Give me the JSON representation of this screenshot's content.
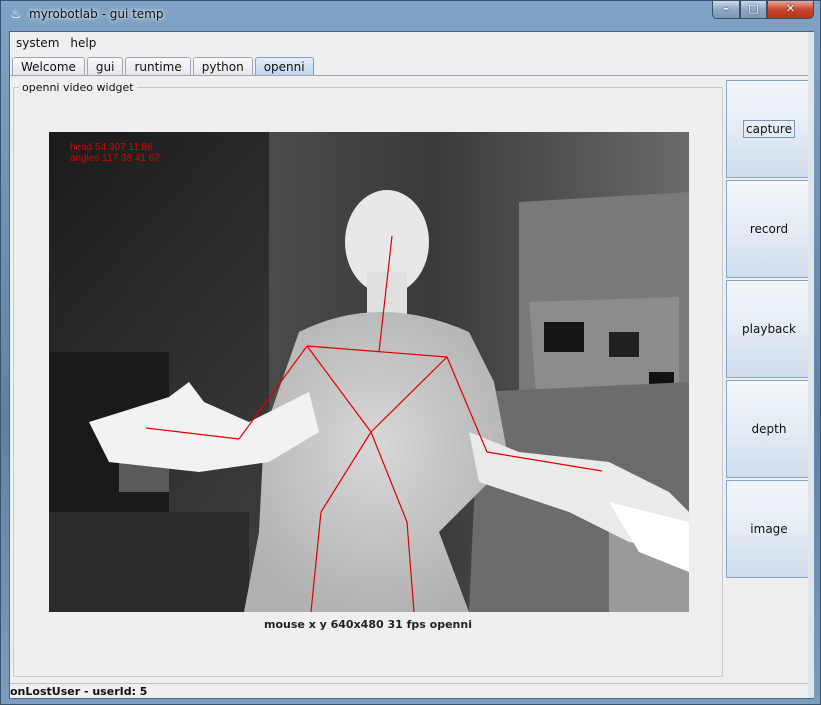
{
  "window": {
    "title": "myrobotlab - gui temp",
    "app_icon": "java-icon",
    "controls": [
      "minimize",
      "maximize",
      "close"
    ]
  },
  "menu": [
    "system",
    "help"
  ],
  "tabs": [
    {
      "label": "Welcome",
      "active": false
    },
    {
      "label": "gui",
      "active": false
    },
    {
      "label": "runtime",
      "active": false
    },
    {
      "label": "python",
      "active": false
    },
    {
      "label": "openni",
      "active": true
    }
  ],
  "widget": {
    "legend": "openni  video widget",
    "overlay_line1": "head 54 307 11.86",
    "overlay_line2": "angles 117 38 41 67",
    "status": "mouse x y  640x480  31 fps  openni"
  },
  "buttons": [
    {
      "label": "capture"
    },
    {
      "label": "record"
    },
    {
      "label": "playback"
    },
    {
      "label": "depth"
    },
    {
      "label": "image"
    }
  ],
  "statusbar": "onLostUser - userId: 5",
  "colors": {
    "skeleton": "#e00000",
    "tab_active": "#bcd3ed",
    "button_gradient_bottom": "#cfdcec"
  }
}
